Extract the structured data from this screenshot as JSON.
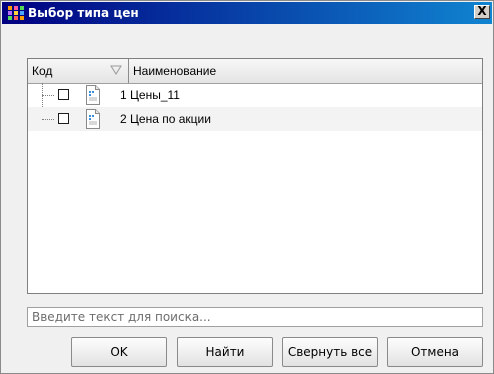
{
  "window": {
    "title": "Выбор типа цен",
    "close_glyph": "X"
  },
  "grid": {
    "columns": {
      "code": "Код",
      "name": "Наименование"
    },
    "rows": [
      {
        "code": "1",
        "name": "Цены_11",
        "checked": false
      },
      {
        "code": "2",
        "name": "Цена по акции",
        "checked": false
      }
    ]
  },
  "search": {
    "placeholder": "Введите текст для поиска..."
  },
  "buttons": {
    "ok": "OK",
    "find": "Найти",
    "collapse_all": "Свернуть все",
    "cancel": "Отмена"
  },
  "icons": [
    "app-icon",
    "close-icon",
    "sort-filter-icon",
    "document-icon"
  ],
  "colors": {
    "titlebar_start": "#000080",
    "titlebar_end": "#1084d0",
    "window_bg": "#f0f0f0"
  }
}
